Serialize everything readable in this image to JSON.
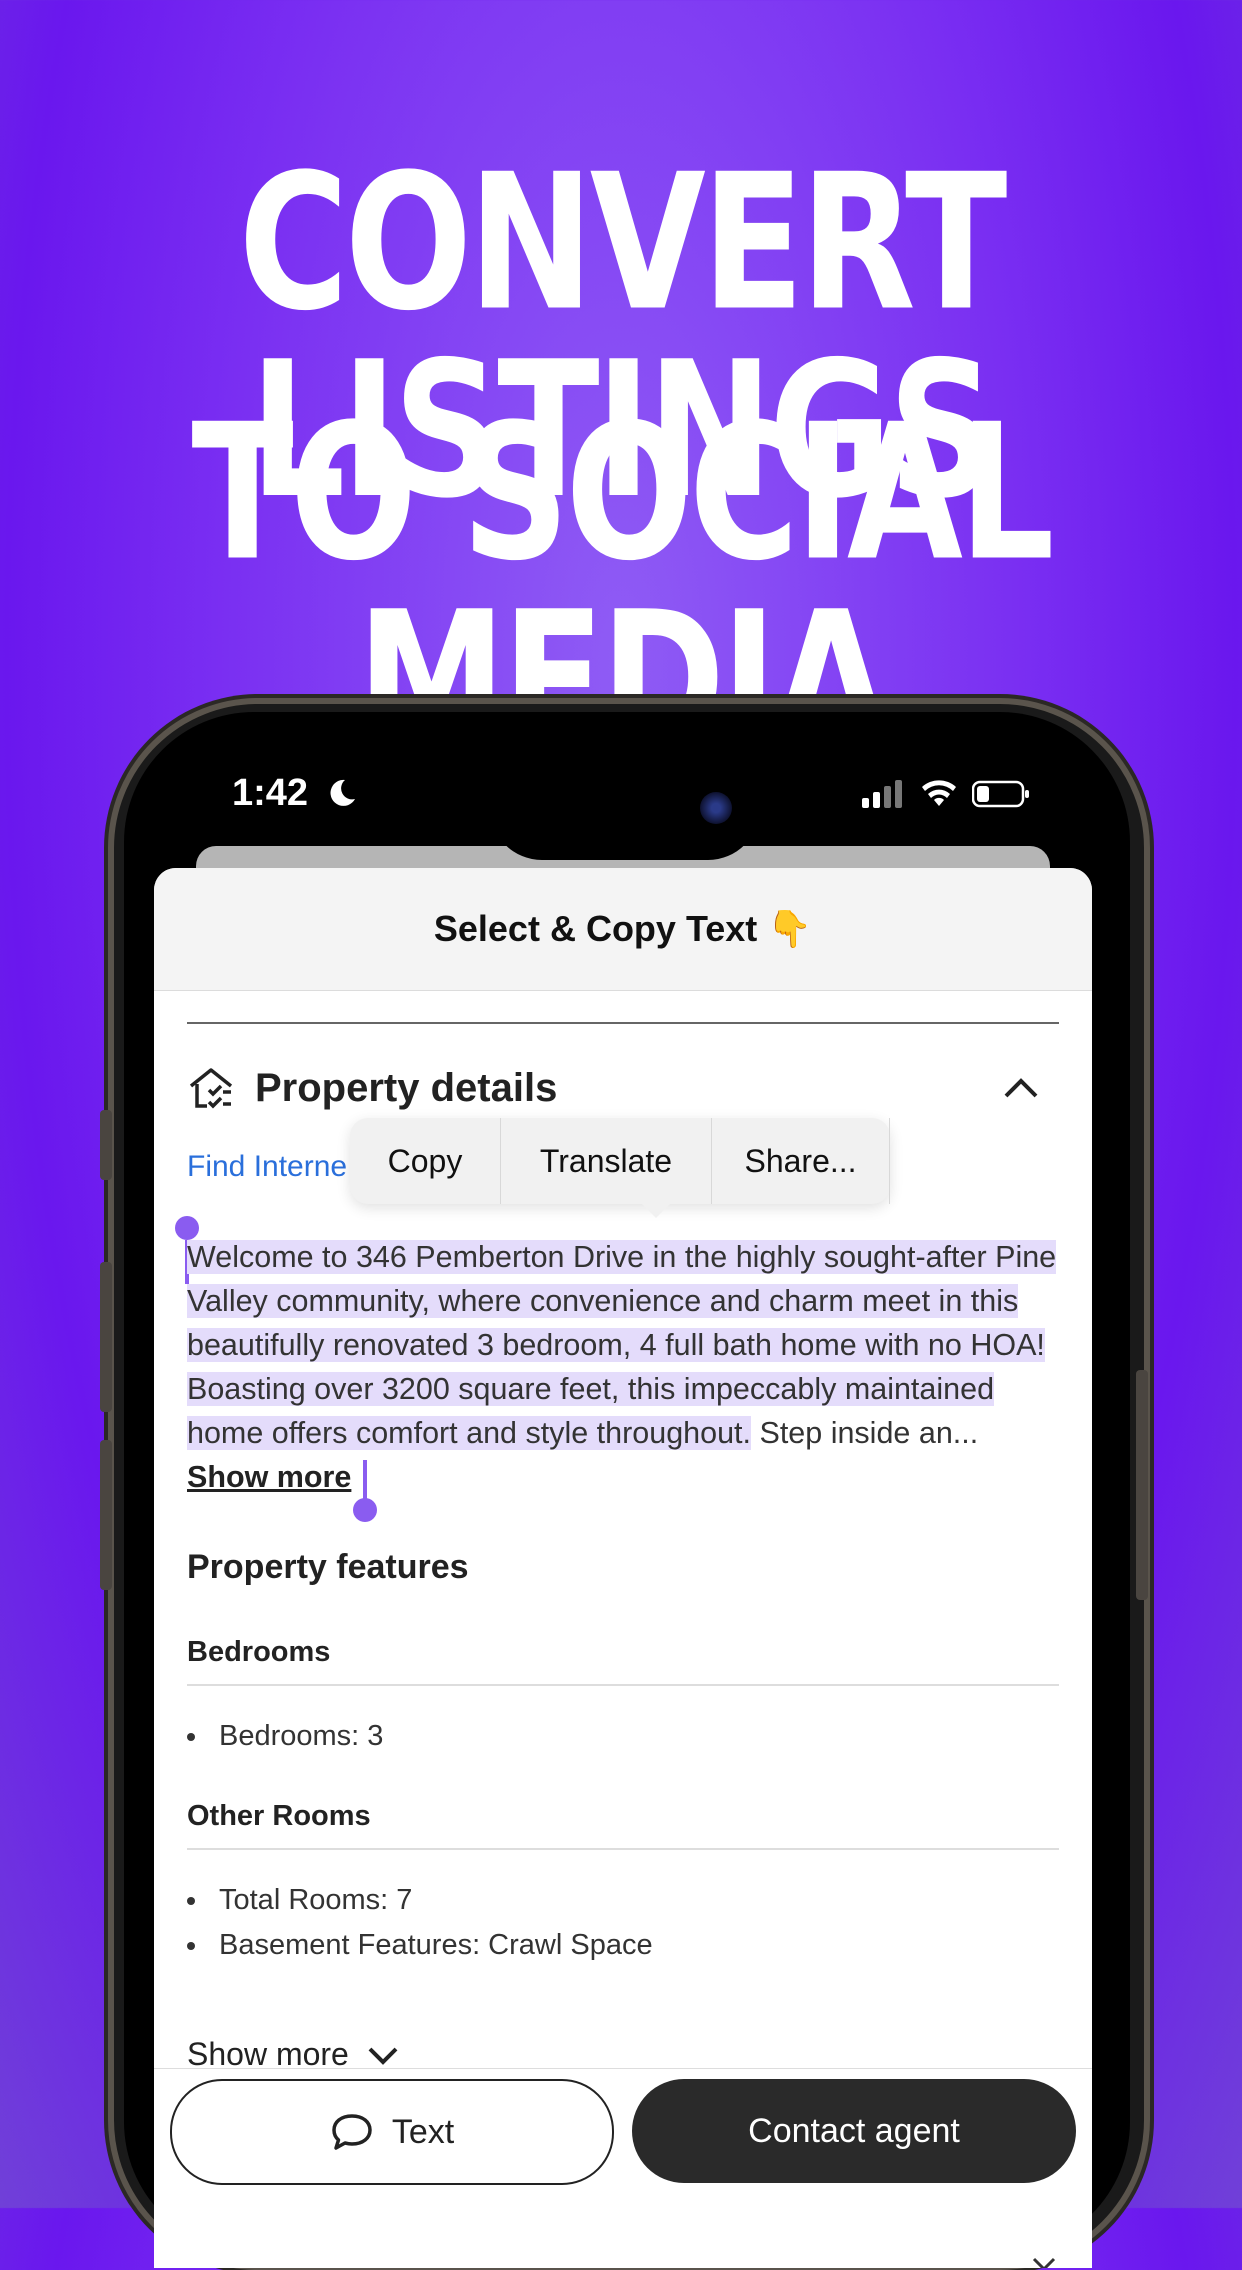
{
  "headline": {
    "line1": "CONVERT LISTINGS",
    "line2": "TO SOCIAL MEDIA"
  },
  "status_bar": {
    "time": "1:42"
  },
  "sheet": {
    "title": "Select & Copy Text 👇"
  },
  "property_details": {
    "title": "Property details",
    "find_link": "Find Interne",
    "description_selected": "Welcome to 346 Pemberton Drive in the highly sought-after Pine Valley community, where convenience and charm meet in this beautifully renovated 3 bedroom, 4 full bath home with no HOA! Boasting over 3200 square feet, this impeccably maintained home offers comfort and style throughout.",
    "description_rest": " Step inside an...",
    "show_more": "Show more"
  },
  "context_menu": {
    "copy": "Copy",
    "translate": "Translate",
    "share": "Share..."
  },
  "features": {
    "title": "Property features",
    "bedrooms_heading": "Bedrooms",
    "bedrooms_items": [
      "Bedrooms: 3"
    ],
    "other_heading": "Other Rooms",
    "other_items": [
      "Total Rooms: 7",
      "Basement Features: Crawl Space"
    ]
  },
  "show_more_bottom": "Show more",
  "buttons": {
    "text": "Text",
    "contact": "Contact agent"
  },
  "colors": {
    "accent": "#8a5cf0",
    "selection": "#e4dcfb",
    "link": "#2a6fdb",
    "background": "#7a2ff2"
  }
}
